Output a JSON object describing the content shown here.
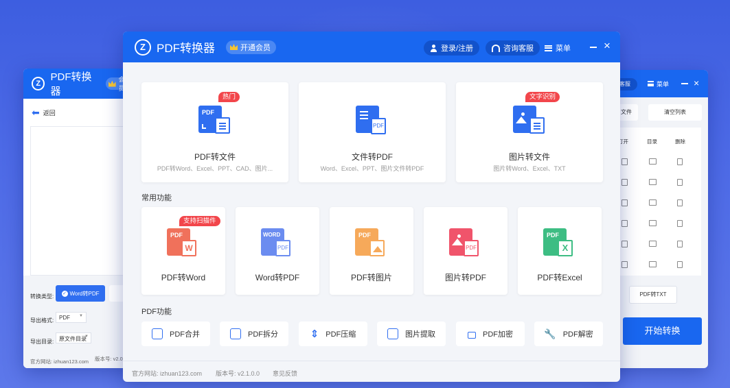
{
  "app": {
    "title": "PDF转换器",
    "vip": "开通会员",
    "login": "登录/注册",
    "service": "咨询客服",
    "menu": "菜单"
  },
  "left_window": {
    "title": "PDF转换器",
    "vip": "会员",
    "back": "返回",
    "convert_type_label": "转换类型:",
    "convert_type_value": "Word转PDF",
    "export_format_label": "导出格式:",
    "export_format_value": "PDF",
    "export_dir_label": "导出目录:",
    "export_dir_value": "原文件目录",
    "website": "官方网站: izhuan123.com",
    "version": "版本号: v2.0"
  },
  "right_window": {
    "service": "询客服",
    "menu": "菜单",
    "add_file": "文件",
    "clear_list": "清空列表",
    "col_open": "打开",
    "col_dir": "目录",
    "col_delete": "删除",
    "pdf_to_txt": "PDF转TXT",
    "start": "开始转换"
  },
  "top_cards": [
    {
      "title": "PDF转文件",
      "sub": "PDF转Word、Excel、PPT、CAD、图片...",
      "tag": "热门",
      "icon": "pdf-to-file-icon",
      "color": "#2f6ef0"
    },
    {
      "title": "文件转PDF",
      "sub": "Word、Excel、PPT、图片文件转PDF",
      "tag": "",
      "icon": "file-to-pdf-icon",
      "color": "#2f6ef0"
    },
    {
      "title": "图片转文件",
      "sub": "图片转Word、Excel、TXT",
      "tag": "文字识别",
      "icon": "image-to-file-icon",
      "color": "#2f6ef0"
    }
  ],
  "common_label": "常用功能",
  "common": [
    {
      "title": "PDF转Word",
      "tag": "支持扫描件",
      "badge": "PDF",
      "color": "#f0715b"
    },
    {
      "title": "Word转PDF",
      "tag": "",
      "badge": "WORD",
      "color": "#6b8cf0"
    },
    {
      "title": "PDF转图片",
      "tag": "",
      "badge": "PDF",
      "color": "#f6a95a"
    },
    {
      "title": "图片转PDF",
      "tag": "",
      "badge": "",
      "color": "#f0546b"
    },
    {
      "title": "PDF转Excel",
      "tag": "",
      "badge": "PDF",
      "color": "#3dbd83"
    }
  ],
  "pdf_label": "PDF功能",
  "tools": [
    {
      "label": "PDF合并",
      "icon": "merge-icon"
    },
    {
      "label": "PDF拆分",
      "icon": "split-icon"
    },
    {
      "label": "PDF压缩",
      "icon": "compress-icon"
    },
    {
      "label": "图片提取",
      "icon": "image-extract-icon"
    },
    {
      "label": "PDF加密",
      "icon": "lock-icon"
    },
    {
      "label": "PDF解密",
      "icon": "key-icon"
    }
  ],
  "footer": {
    "website": "官方网站: izhuan123.com",
    "version": "版本号: v2.1.0.0",
    "feedback": "意见反馈"
  }
}
